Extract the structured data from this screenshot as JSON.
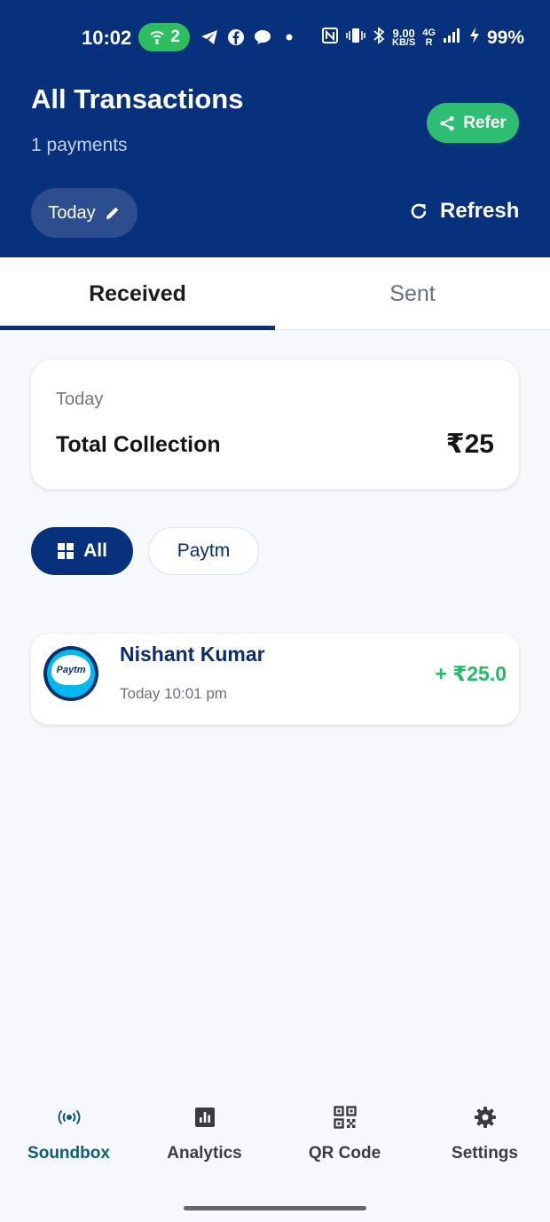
{
  "status_bar": {
    "time": "10:02",
    "hotspot_count": "2",
    "speed_value": "9.00",
    "speed_unit": "KB/S",
    "network_type": "4G",
    "battery": "99%"
  },
  "header": {
    "title": "All Transactions",
    "subtitle": "1 payments",
    "refer_label": "Refer",
    "date_chip_label": "Today",
    "refresh_label": "Refresh"
  },
  "tabs": [
    {
      "label": "Received",
      "active": true
    },
    {
      "label": "Sent",
      "active": false
    }
  ],
  "summary": {
    "period": "Today",
    "label": "Total Collection",
    "amount": "₹25"
  },
  "filters": [
    {
      "label": "All",
      "active": true
    },
    {
      "label": "Paytm",
      "active": false
    }
  ],
  "transactions": [
    {
      "name": "Nishant Kumar",
      "time": "Today 10:01 pm",
      "amount": "+ ₹25.0",
      "provider": "Paytm"
    }
  ],
  "bottom_nav": [
    {
      "label": "Soundbox",
      "icon": "soundbox-icon",
      "active": true
    },
    {
      "label": "Analytics",
      "icon": "analytics-icon",
      "active": false
    },
    {
      "label": "QR Code",
      "icon": "qr-code-icon",
      "active": false
    },
    {
      "label": "Settings",
      "icon": "gear-icon",
      "active": false
    }
  ],
  "colors": {
    "primary": "#07317C",
    "accent_green": "#2DBE72",
    "amount_green": "#26B86A",
    "nav_active": "#0D5E78"
  }
}
